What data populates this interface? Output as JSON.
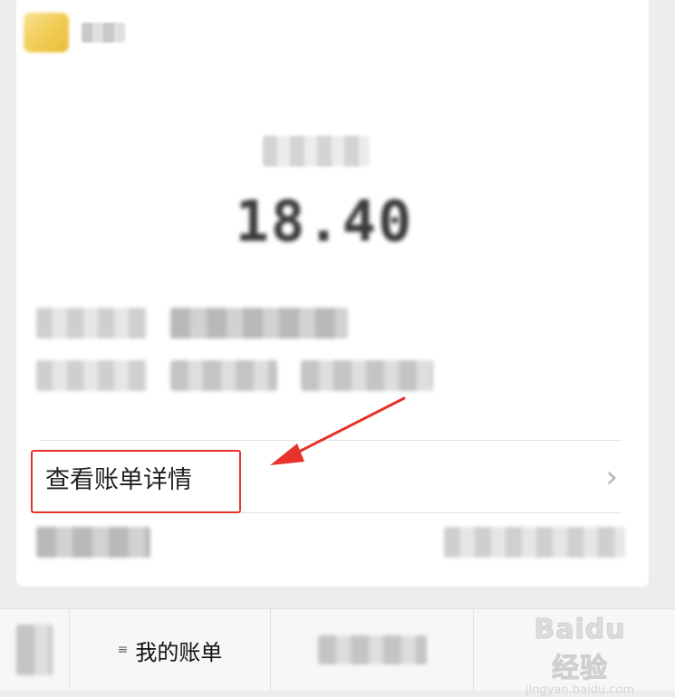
{
  "card": {
    "amount": "18.40",
    "bill_details_label": "查看账单详情",
    "chevron": "›"
  },
  "bottom_bar": {
    "my_bills_icon": "≡",
    "my_bills_label": "我的账单"
  },
  "watermark": {
    "logo": "Baidu经验",
    "sub": "jingyan.baidu.com"
  },
  "colors": {
    "highlight": "#e8322c",
    "background": "#ededed",
    "card": "#ffffff"
  }
}
